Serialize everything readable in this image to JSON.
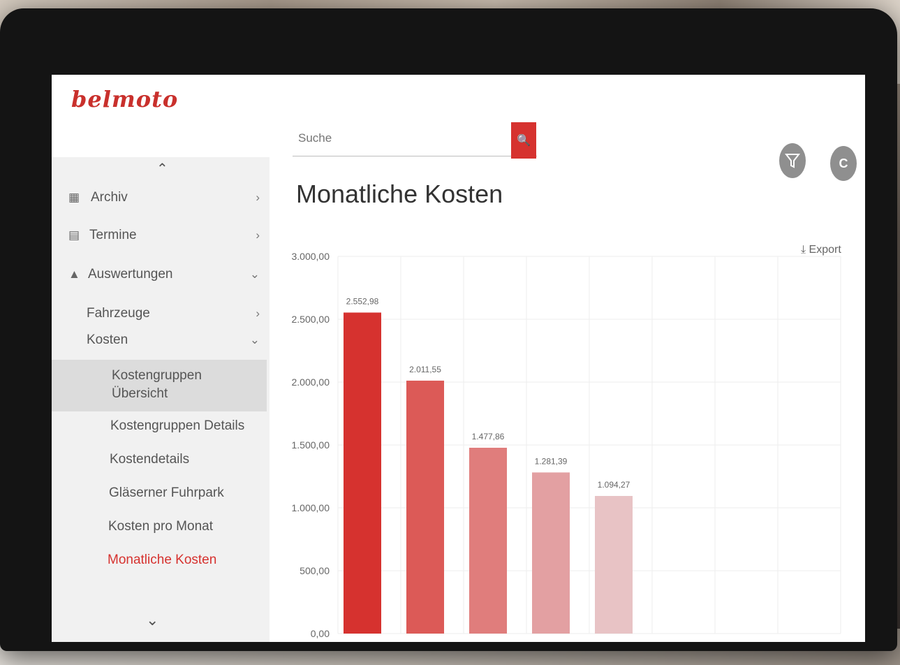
{
  "app": {
    "logo": "belmoto"
  },
  "search": {
    "placeholder": "Suche"
  },
  "header": {
    "user_initial": "C"
  },
  "sidebar": {
    "items": [
      {
        "label": "Archiv"
      },
      {
        "label": "Termine"
      },
      {
        "label": "Auswertungen"
      },
      {
        "label": "Fahrzeuge"
      },
      {
        "label": "Kosten"
      }
    ],
    "sub_items": [
      {
        "label": "Kostengruppen Übersicht"
      },
      {
        "label": "Kostengruppen Details"
      },
      {
        "label": "Kostendetails"
      },
      {
        "label": "Gläserner Fuhrpark"
      },
      {
        "label": "Kosten pro Monat"
      },
      {
        "label": "Monatliche Kosten"
      }
    ]
  },
  "main": {
    "title": "Monatliche Kosten",
    "export_label": "Export"
  },
  "colors": {
    "accent": "#d6322f"
  },
  "chart_data": {
    "type": "bar",
    "ylim": [
      0,
      3000
    ],
    "yticks": [
      "0,00",
      "500,00",
      "1.000,00",
      "1.500,00",
      "2.000,00",
      "2.500,00",
      "3.000,00"
    ],
    "values": [
      2552.98,
      2011.55,
      1477.86,
      1281.39,
      1094.27
    ],
    "labels": [
      "2.552,98",
      "2.011,55",
      "1.477,86",
      "1.281,39",
      "1.094,27"
    ],
    "colors": [
      "#d6322f",
      "#dc5a57",
      "#e07d7c",
      "#e3a0a2",
      "#e8c3c5"
    ],
    "grid": true
  }
}
